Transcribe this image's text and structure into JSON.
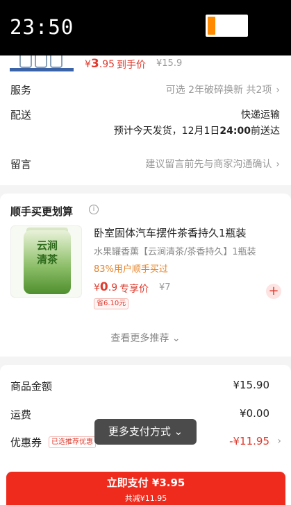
{
  "status_bar": {
    "time": "23:50",
    "battery_level": 0.2,
    "battery_color": "#ff8a00"
  },
  "product_peek": {
    "currency": "¥",
    "price_int": "3",
    "price_dec": ".95",
    "price_tag": "到手价",
    "original_price": "¥15.9"
  },
  "service": {
    "label": "服务",
    "value": "可选 2年破碎换新 共2项"
  },
  "delivery": {
    "label": "配送",
    "method": "快递运输",
    "estimate_prefix": "预计今天发货，12月1日",
    "estimate_time": "24:00",
    "estimate_suffix": "前送达"
  },
  "message": {
    "label": "留言",
    "placeholder": "建议留言前先与商家沟通确认"
  },
  "recommend": {
    "title": "顺手买更划算",
    "info_icon": "info-icon",
    "item": {
      "image_text": "云涧清茶",
      "title": "卧室固体汽车摆件茶香持久1瓶装",
      "subtitle": "水果罐香薰【云涧清茶/茶香持久】1瓶装",
      "social_proof": "83%用户顺手买过",
      "currency": "¥",
      "price_int": "0",
      "price_dec": ".9",
      "price_tag": "专享价",
      "original_price": "¥7",
      "save_badge": "省6.10元",
      "add_icon": "plus-icon"
    },
    "more_label": "查看更多推荐"
  },
  "summary": {
    "goods_label": "商品金额",
    "goods_value": "¥15.90",
    "shipping_label": "运费",
    "shipping_value": "¥0.00",
    "coupon_label": "优惠券",
    "coupon_chip": "已选推荐优惠",
    "coupon_value": "-¥11.95"
  },
  "toast": {
    "label": "更多支付方式"
  },
  "pay_button": {
    "label": "立即支付 ¥3.95",
    "sub_label": "共减¥11.95"
  },
  "colors": {
    "accent": "#e03a2d",
    "pay_button": "#ef2b1d",
    "hint_orange": "#e5842a"
  }
}
